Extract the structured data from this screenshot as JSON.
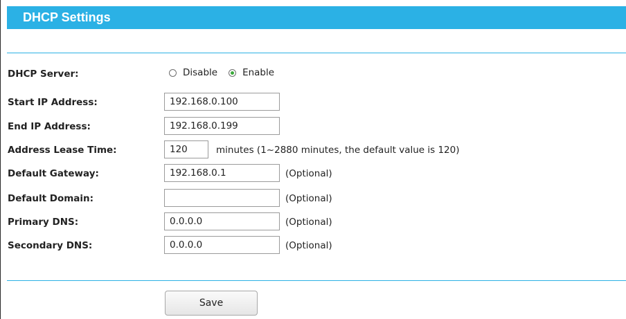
{
  "header": {
    "title": "DHCP Settings"
  },
  "dhcp_server": {
    "label": "DHCP Server:",
    "options": [
      {
        "label": "Disable",
        "selected": false
      },
      {
        "label": "Enable",
        "selected": true
      }
    ]
  },
  "start_ip": {
    "label": "Start IP Address:",
    "value": "192.168.0.100"
  },
  "end_ip": {
    "label": "End IP Address:",
    "value": "192.168.0.199"
  },
  "lease_time": {
    "label": "Address Lease Time:",
    "value": "120",
    "hint": "minutes (1~2880 minutes, the default value is 120)"
  },
  "gateway": {
    "label": "Default Gateway:",
    "value": "192.168.0.1",
    "hint": "(Optional)"
  },
  "domain": {
    "label": "Default Domain:",
    "value": "",
    "hint": "(Optional)"
  },
  "primary_dns": {
    "label": "Primary DNS:",
    "value": "0.0.0.0",
    "hint": "(Optional)"
  },
  "secondary_dns": {
    "label": "Secondary DNS:",
    "value": "0.0.0.0",
    "hint": "(Optional)"
  },
  "actions": {
    "save_label": "Save"
  },
  "colors": {
    "accent": "#2bb1e5",
    "radio_selected": "#3aa93a"
  }
}
